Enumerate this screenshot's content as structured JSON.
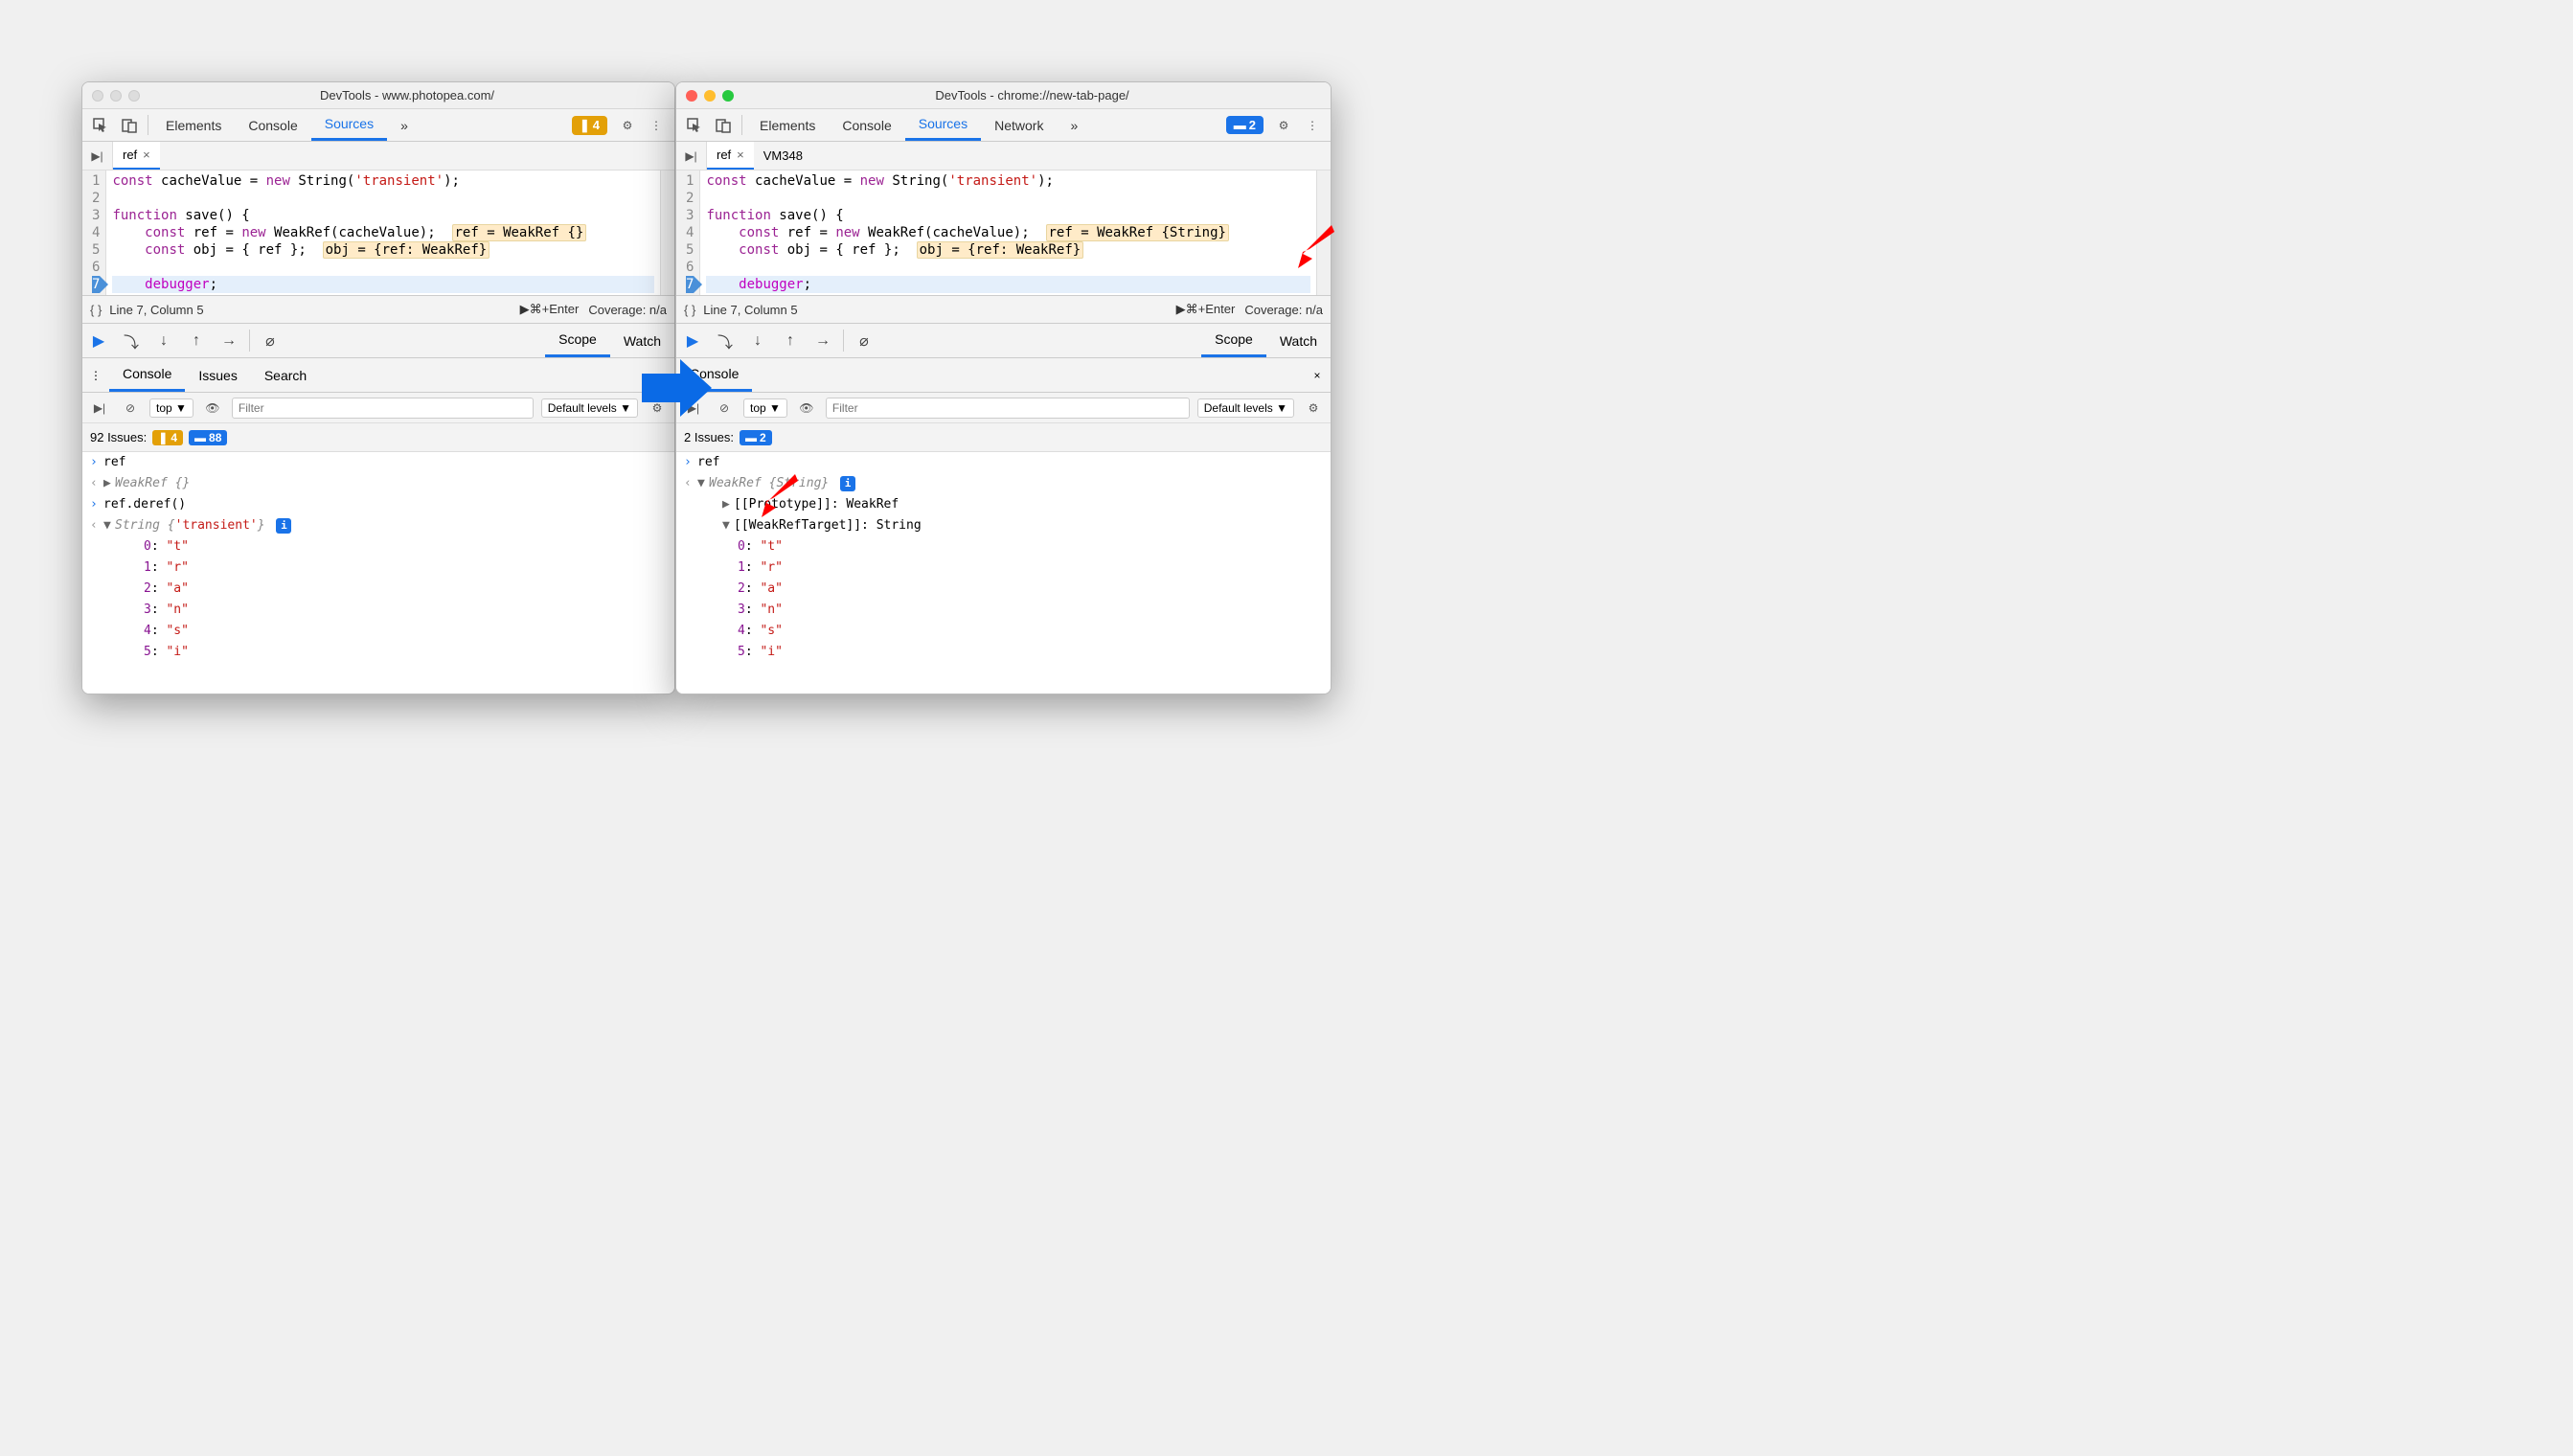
{
  "left": {
    "title": "DevTools - www.photopea.com/",
    "tabs": [
      "Elements",
      "Console",
      "Sources"
    ],
    "activeTab": "Sources",
    "more": "»",
    "warnBadge": "4",
    "fileTab": "ref",
    "code": {
      "lines": [
        {
          "n": "1",
          "html": "<span class='cl-kw'>const</span> cacheValue = <span class='cl-kw'>new</span> String(<span class='cl-str'>'transient'</span>);"
        },
        {
          "n": "2",
          "html": ""
        },
        {
          "n": "3",
          "html": "<span class='cl-kw'>function</span> save() {"
        },
        {
          "n": "4",
          "html": "    <span class='cl-kw'>const</span> ref = <span class='cl-kw'>new</span> WeakRef(cacheValue);  <span class='hl'>ref = WeakRef {}</span>"
        },
        {
          "n": "5",
          "html": "    <span class='cl-kw'>const</span> obj = { ref };  <span class='hl'>obj = {ref: WeakRef}</span>"
        },
        {
          "n": "6",
          "html": ""
        },
        {
          "n": "7",
          "html": "    <span class='dbg-kw'>debugger</span>;",
          "bp": true,
          "cur": true
        }
      ]
    },
    "status": {
      "pos": "Line 7, Column 5",
      "run": "⌘+Enter",
      "cov": "Coverage: n/a"
    },
    "debugTabs": {
      "scope": "Scope",
      "watch": "Watch"
    },
    "drawerTabs": [
      "Console",
      "Issues",
      "Search"
    ],
    "consoleToolbar": {
      "context": "top",
      "filterPlaceholder": "Filter",
      "levels": "Default levels"
    },
    "issuesBar": {
      "label": "92 Issues:",
      "warn": "4",
      "info": "88"
    },
    "console": [
      {
        "type": "in",
        "text": "ref"
      },
      {
        "type": "out",
        "html": "<span class='tree-arrow'>▶</span><span class='obj'>WeakRef {}</span>"
      },
      {
        "type": "in",
        "text": "ref.deref()"
      },
      {
        "type": "out",
        "html": "<span class='tree-arrow'>▼</span><span class='obj'>String {</span><span class='cl-str'>'transient'</span><span class='obj'>}</span> <span class='info-badge'>i</span>"
      },
      {
        "type": "tree",
        "indent": 2,
        "html": "<span class='prop-key'>0</span>: <span class='prop-val-str'>\"t\"</span>"
      },
      {
        "type": "tree",
        "indent": 2,
        "html": "<span class='prop-key'>1</span>: <span class='prop-val-str'>\"r\"</span>"
      },
      {
        "type": "tree",
        "indent": 2,
        "html": "<span class='prop-key'>2</span>: <span class='prop-val-str'>\"a\"</span>"
      },
      {
        "type": "tree",
        "indent": 2,
        "html": "<span class='prop-key'>3</span>: <span class='prop-val-str'>\"n\"</span>"
      },
      {
        "type": "tree",
        "indent": 2,
        "html": "<span class='prop-key'>4</span>: <span class='prop-val-str'>\"s\"</span>"
      },
      {
        "type": "tree",
        "indent": 2,
        "html": "<span class='prop-key'>5</span>: <span class='prop-val-str'>\"i\"</span>"
      }
    ]
  },
  "right": {
    "title": "DevTools - chrome://new-tab-page/",
    "tabs": [
      "Elements",
      "Console",
      "Sources",
      "Network"
    ],
    "activeTab": "Sources",
    "more": "»",
    "infoBadge": "2",
    "fileTabs": [
      {
        "name": "ref",
        "active": true
      },
      {
        "name": "VM348",
        "active": false
      }
    ],
    "code": {
      "lines": [
        {
          "n": "1",
          "html": "<span class='cl-kw'>const</span> cacheValue = <span class='cl-kw'>new</span> String(<span class='cl-str'>'transient'</span>);"
        },
        {
          "n": "2",
          "html": ""
        },
        {
          "n": "3",
          "html": "<span class='cl-kw'>function</span> save() {"
        },
        {
          "n": "4",
          "html": "    <span class='cl-kw'>const</span> ref = <span class='cl-kw'>new</span> WeakRef(cacheValue);  <span class='hl'>ref = WeakRef {String}</span>"
        },
        {
          "n": "5",
          "html": "    <span class='cl-kw'>const</span> obj = { ref };  <span class='hl'>obj = {ref: WeakRef}</span>"
        },
        {
          "n": "6",
          "html": ""
        },
        {
          "n": "7",
          "html": "    <span class='dbg-kw'>debugger</span>;",
          "bp": true,
          "cur": true
        }
      ]
    },
    "status": {
      "pos": "Line 7, Column 5",
      "run": "⌘+Enter",
      "cov": "Coverage: n/a"
    },
    "debugTabs": {
      "scope": "Scope",
      "watch": "Watch"
    },
    "drawerTabs": [
      "Console"
    ],
    "consoleToolbar": {
      "context": "top",
      "filterPlaceholder": "Filter",
      "levels": "Default levels"
    },
    "issuesBar": {
      "label": "2 Issues:",
      "info": "2"
    },
    "console": [
      {
        "type": "in",
        "text": "ref"
      },
      {
        "type": "out",
        "html": "<span class='tree-arrow'>▼</span><span class='obj'>WeakRef {String}</span> <span class='info-badge'>i</span>"
      },
      {
        "type": "tree",
        "indent": 1,
        "html": "<span class='tree-arrow'>▶</span>[[Prototype]]: WeakRef"
      },
      {
        "type": "tree",
        "indent": 1,
        "html": "<span class='tree-arrow'>▼</span>[[WeakRefTarget]]: String"
      },
      {
        "type": "tree",
        "indent": 2,
        "html": "<span class='prop-key'>0</span>: <span class='prop-val-str'>\"t\"</span>"
      },
      {
        "type": "tree",
        "indent": 2,
        "html": "<span class='prop-key'>1</span>: <span class='prop-val-str'>\"r\"</span>"
      },
      {
        "type": "tree",
        "indent": 2,
        "html": "<span class='prop-key'>2</span>: <span class='prop-val-str'>\"a\"</span>"
      },
      {
        "type": "tree",
        "indent": 2,
        "html": "<span class='prop-key'>3</span>: <span class='prop-val-str'>\"n\"</span>"
      },
      {
        "type": "tree",
        "indent": 2,
        "html": "<span class='prop-key'>4</span>: <span class='prop-val-str'>\"s\"</span>"
      },
      {
        "type": "tree",
        "indent": 2,
        "html": "<span class='prop-key'>5</span>: <span class='prop-val-str'>\"i\"</span>"
      }
    ]
  }
}
